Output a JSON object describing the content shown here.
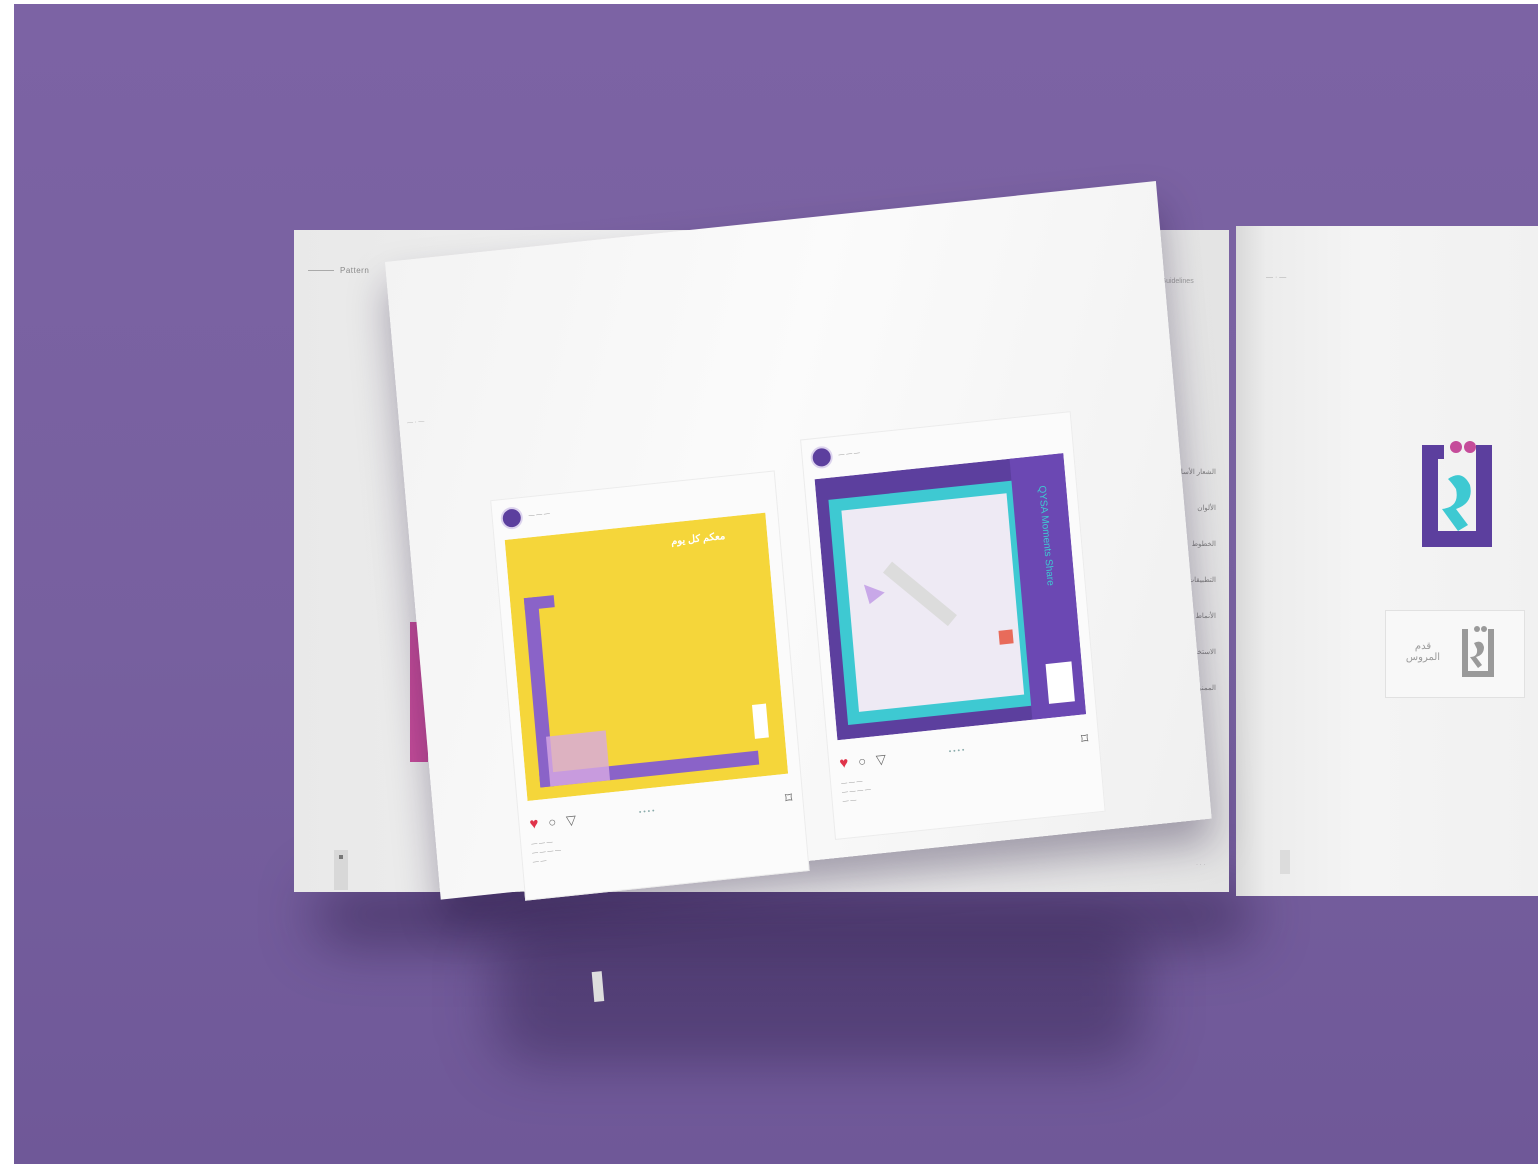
{
  "scene": {
    "background_color": "#7a62a2",
    "accent_purple": "#5c3f9e",
    "accent_teal": "#3ec9d2",
    "accent_yellow": "#f5d63a",
    "accent_pink": "#c54c9a"
  },
  "left_page": {
    "header": "Pattern",
    "sidebar_title": "Brand Guidelines",
    "toc": [
      "الشعار الأساسي",
      "الألوان",
      "الخطوط",
      "التطبيقات",
      "الأنماط",
      "الاستخدامات",
      "الممنوعات"
    ]
  },
  "turning_page": {
    "post_left": {
      "icons": [
        "heart-icon",
        "comment-icon",
        "share-icon",
        "bookmark-icon"
      ],
      "arabic_text": "معكم كل يوم"
    },
    "post_right": {
      "vertical_text": "QYSA Moments Share",
      "icons": [
        "heart-icon",
        "comment-icon",
        "share-icon",
        "bookmark-icon"
      ]
    }
  },
  "right_page": {
    "logo_card_text": "قدم المروس"
  }
}
